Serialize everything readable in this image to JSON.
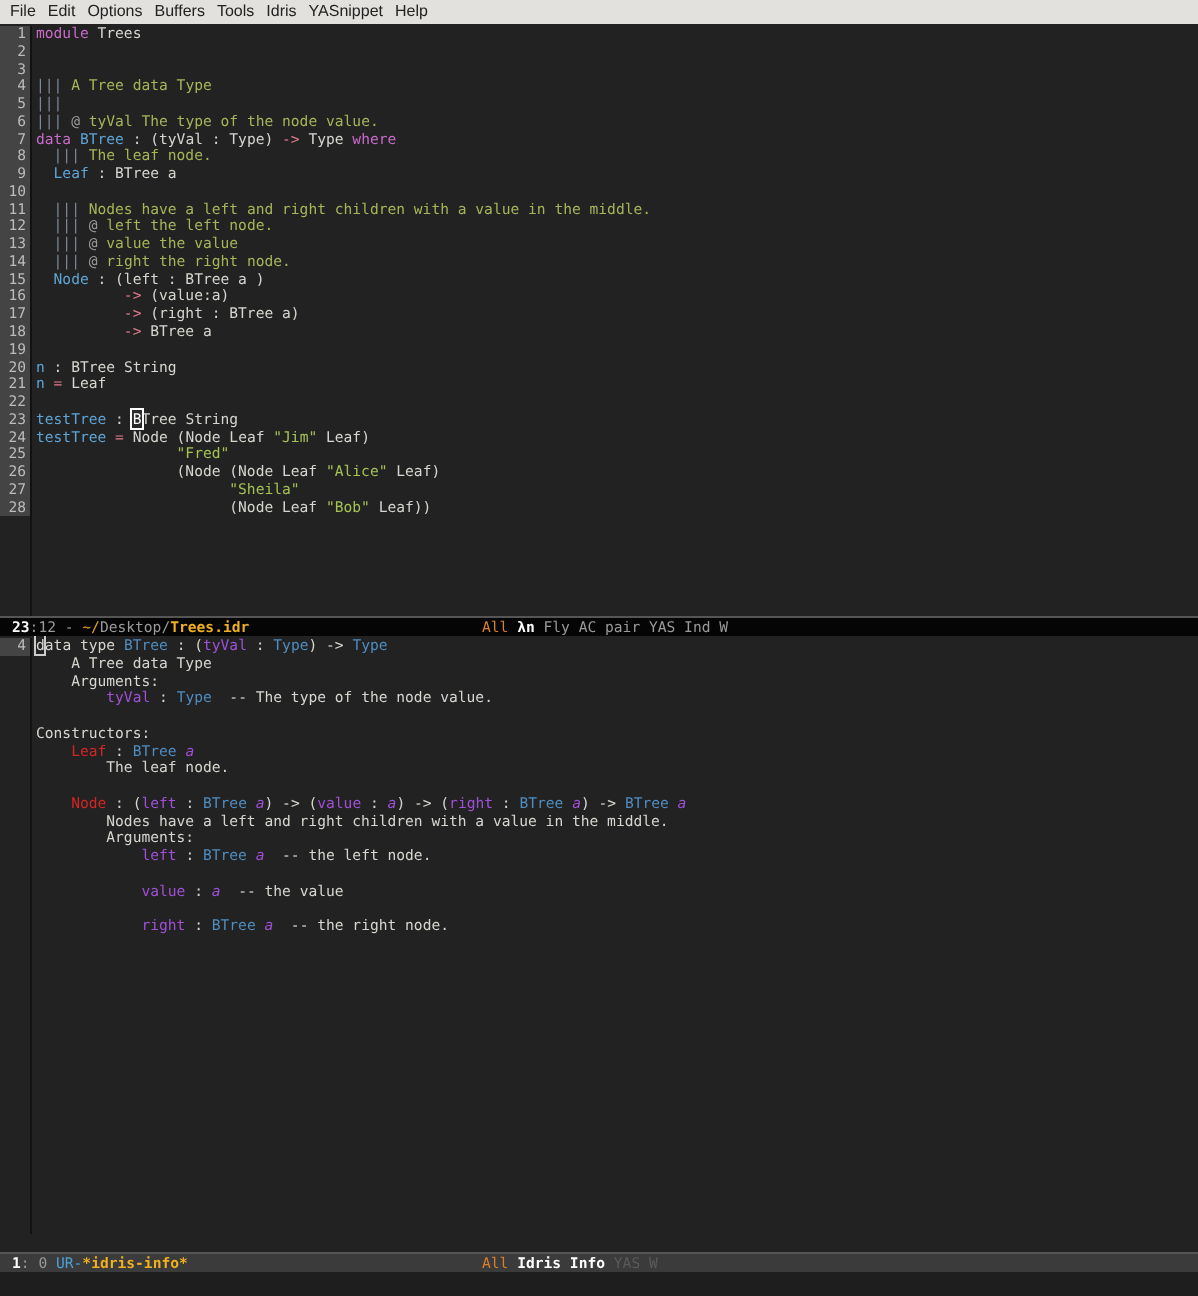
{
  "menu_bar": [
    "File",
    "Edit",
    "Options",
    "Buffers",
    "Tools",
    "Idris",
    "YASnippet",
    "Help"
  ],
  "editor": {
    "lines": [
      {
        "number": "1",
        "tokens": [
          {
            "kind": "keyword",
            "text": "module"
          },
          {
            "kind": "plain",
            "text": " Trees"
          }
        ]
      },
      {
        "number": "2"
      },
      {
        "number": "3"
      },
      {
        "number": "4",
        "tokens": [
          {
            "kind": "docbar",
            "text": "|||"
          },
          {
            "kind": "doc",
            "text": " A Tree data Type"
          }
        ]
      },
      {
        "number": "5",
        "tokens": [
          {
            "kind": "docbar",
            "text": "|||"
          }
        ]
      },
      {
        "number": "6",
        "tokens": [
          {
            "kind": "docbar",
            "text": "|||"
          },
          {
            "kind": "at",
            "text": " @"
          },
          {
            "kind": "doc",
            "text": " tyVal The type of the node value."
          }
        ]
      },
      {
        "number": "7",
        "tokens": [
          {
            "kind": "keyword",
            "text": "data"
          },
          {
            "kind": "type",
            "text": " BTree"
          },
          {
            "kind": "plain",
            "text": " : (tyVal : Type) "
          },
          {
            "kind": "arrow",
            "text": "->"
          },
          {
            "kind": "plain",
            "text": " Type "
          },
          {
            "kind": "keyword",
            "text": "where"
          }
        ]
      },
      {
        "number": "8",
        "tokens": [
          {
            "kind": "docbar",
            "text": "  |||"
          },
          {
            "kind": "doc",
            "text": " The leaf node."
          }
        ]
      },
      {
        "number": "9",
        "tokens": [
          {
            "kind": "type",
            "text": "  Leaf"
          },
          {
            "kind": "plain",
            "text": " : BTree a"
          }
        ]
      },
      {
        "number": "10"
      },
      {
        "number": "11",
        "tokens": [
          {
            "kind": "docbar",
            "text": "  |||"
          },
          {
            "kind": "doc",
            "text": " Nodes have a left and right children with a value in the middle."
          }
        ]
      },
      {
        "number": "12",
        "tokens": [
          {
            "kind": "docbar",
            "text": "  |||"
          },
          {
            "kind": "at",
            "text": " @"
          },
          {
            "kind": "doc",
            "text": " left the left node."
          }
        ]
      },
      {
        "number": "13",
        "tokens": [
          {
            "kind": "docbar",
            "text": "  |||"
          },
          {
            "kind": "at",
            "text": " @"
          },
          {
            "kind": "doc",
            "text": " value the value"
          }
        ]
      },
      {
        "number": "14",
        "tokens": [
          {
            "kind": "docbar",
            "text": "  |||"
          },
          {
            "kind": "at",
            "text": " @"
          },
          {
            "kind": "doc",
            "text": " right the right node."
          }
        ]
      },
      {
        "number": "15",
        "tokens": [
          {
            "kind": "type",
            "text": "  Node"
          },
          {
            "kind": "plain",
            "text": " : (left : BTree a )"
          }
        ]
      },
      {
        "number": "16",
        "tokens": [
          {
            "kind": "arrow",
            "text": "          ->"
          },
          {
            "kind": "plain",
            "text": " (value:a)"
          }
        ]
      },
      {
        "number": "17",
        "tokens": [
          {
            "kind": "arrow",
            "text": "          ->"
          },
          {
            "kind": "plain",
            "text": " (right : BTree a)"
          }
        ]
      },
      {
        "number": "18",
        "tokens": [
          {
            "kind": "arrow",
            "text": "          ->"
          },
          {
            "kind": "plain",
            "text": " BTree a"
          }
        ]
      },
      {
        "number": "19"
      },
      {
        "number": "20",
        "tokens": [
          {
            "kind": "type",
            "text": "n"
          },
          {
            "kind": "plain",
            "text": " : BTree String"
          }
        ]
      },
      {
        "number": "21",
        "tokens": [
          {
            "kind": "type",
            "text": "n"
          },
          {
            "kind": "arrow",
            "text": " ="
          },
          {
            "kind": "plain",
            "text": " Leaf"
          }
        ]
      },
      {
        "number": "22"
      },
      {
        "number": "23",
        "tokens": [
          {
            "kind": "type",
            "text": "testTree"
          },
          {
            "kind": "plain",
            "text": " : "
          },
          {
            "kind": "cursor",
            "text": "B"
          },
          {
            "kind": "plain",
            "text": "Tree String"
          }
        ]
      },
      {
        "number": "24",
        "tokens": [
          {
            "kind": "type",
            "text": "testTree"
          },
          {
            "kind": "arrow",
            "text": " ="
          },
          {
            "kind": "plain",
            "text": " Node (Node Leaf "
          },
          {
            "kind": "string",
            "text": "\"Jim\""
          },
          {
            "kind": "plain",
            "text": " Leaf)"
          }
        ]
      },
      {
        "number": "25",
        "tokens": [
          {
            "kind": "string",
            "text": "                \"Fred\""
          }
        ]
      },
      {
        "number": "26",
        "tokens": [
          {
            "kind": "plain",
            "text": "                (Node (Node Leaf "
          },
          {
            "kind": "string",
            "text": "\"Alice\""
          },
          {
            "kind": "plain",
            "text": " Leaf)"
          }
        ]
      },
      {
        "number": "27",
        "tokens": [
          {
            "kind": "string",
            "text": "                      \"Sheila\""
          }
        ]
      },
      {
        "number": "28",
        "tokens": [
          {
            "kind": "plain",
            "text": "                      (Node Leaf "
          },
          {
            "kind": "string",
            "text": "\"Bob\""
          },
          {
            "kind": "plain",
            "text": " Leaf))"
          }
        ]
      }
    ],
    "mode_line": {
      "active": true,
      "left": [
        {
          "kind": "bold",
          "text": "23"
        },
        {
          "kind": "dim",
          "text": ":12 - "
        },
        {
          "kind": "path",
          "text": "~/"
        },
        {
          "kind": "dim",
          "text": "Desktop/"
        },
        {
          "kind": "file",
          "text": "Trees.idr"
        }
      ],
      "right": [
        {
          "kind": "orange",
          "text": "All "
        },
        {
          "kind": "bold",
          "text": "λn"
        },
        {
          "kind": "dim",
          "text": " Fly AC pair YAS Ind W"
        }
      ]
    }
  },
  "info": {
    "lines": [
      {
        "kind": "text",
        "number": "4",
        "tokens": [
          {
            "kind": "cursor-hollow",
            "text": "d"
          },
          {
            "kind": "plain",
            "text": "ata type "
          },
          {
            "kind": "itype",
            "text": "BTree"
          },
          {
            "kind": "plain",
            "text": " : ("
          },
          {
            "kind": "param",
            "text": "tyVal"
          },
          {
            "kind": "plain",
            "text": " : "
          },
          {
            "kind": "itype",
            "text": "Type"
          },
          {
            "kind": "plain",
            "text": ") -> "
          },
          {
            "kind": "itype",
            "text": "Type"
          }
        ]
      },
      {
        "kind": "text",
        "tokens": [
          {
            "kind": "plain",
            "text": "    A Tree data Type"
          }
        ]
      },
      {
        "kind": "text",
        "tokens": [
          {
            "kind": "plain",
            "text": "    Arguments:"
          }
        ]
      },
      {
        "kind": "text",
        "tokens": [
          {
            "kind": "param",
            "text": "        tyVal"
          },
          {
            "kind": "plain",
            "text": " : "
          },
          {
            "kind": "itype",
            "text": "Type"
          },
          {
            "kind": "plain",
            "text": "  -- The type of the node value."
          }
        ]
      },
      {
        "kind": "blank"
      },
      {
        "kind": "text",
        "tokens": [
          {
            "kind": "plain",
            "text": "Constructors:"
          }
        ]
      },
      {
        "kind": "text",
        "tokens": [
          {
            "kind": "ctor",
            "text": "    Leaf"
          },
          {
            "kind": "plain",
            "text": " : "
          },
          {
            "kind": "itype",
            "text": "BTree"
          },
          {
            "kind": "tyvar",
            "text": " a"
          }
        ]
      },
      {
        "kind": "text",
        "tokens": [
          {
            "kind": "plain",
            "text": "        The leaf node."
          }
        ]
      },
      {
        "kind": "blank"
      },
      {
        "kind": "text",
        "tokens": [
          {
            "kind": "ctor",
            "text": "    Node"
          },
          {
            "kind": "plain",
            "text": " : ("
          },
          {
            "kind": "param",
            "text": "left"
          },
          {
            "kind": "plain",
            "text": " : "
          },
          {
            "kind": "itype",
            "text": "BTree"
          },
          {
            "kind": "tyvar",
            "text": " a"
          },
          {
            "kind": "plain",
            "text": ") -> ("
          },
          {
            "kind": "param",
            "text": "value"
          },
          {
            "kind": "plain",
            "text": " : "
          },
          {
            "kind": "tyvar",
            "text": "a"
          },
          {
            "kind": "plain",
            "text": ") -> ("
          },
          {
            "kind": "param",
            "text": "right"
          },
          {
            "kind": "plain",
            "text": " : "
          },
          {
            "kind": "itype",
            "text": "BTree"
          },
          {
            "kind": "tyvar",
            "text": " a"
          },
          {
            "kind": "plain",
            "text": ") -> "
          },
          {
            "kind": "itype",
            "text": "BTree"
          },
          {
            "kind": "tyvar",
            "text": " a"
          }
        ]
      },
      {
        "kind": "text",
        "tokens": [
          {
            "kind": "plain",
            "text": "        Nodes have a left and right children with a value in the middle."
          }
        ]
      },
      {
        "kind": "text",
        "tokens": [
          {
            "kind": "plain",
            "text": "        Arguments:"
          }
        ]
      },
      {
        "kind": "text",
        "tokens": [
          {
            "kind": "param",
            "text": "            left"
          },
          {
            "kind": "plain",
            "text": " : "
          },
          {
            "kind": "itype",
            "text": "BTree"
          },
          {
            "kind": "tyvar",
            "text": " a"
          },
          {
            "kind": "plain",
            "text": "  -- the left node."
          }
        ]
      },
      {
        "kind": "blank"
      },
      {
        "kind": "text",
        "tokens": [
          {
            "kind": "param",
            "text": "            value"
          },
          {
            "kind": "plain",
            "text": " : "
          },
          {
            "kind": "tyvar",
            "text": "a"
          },
          {
            "kind": "plain",
            "text": "  -- the value"
          }
        ]
      },
      {
        "kind": "blank"
      },
      {
        "kind": "text",
        "tokens": [
          {
            "kind": "param",
            "text": "            right"
          },
          {
            "kind": "plain",
            "text": " : "
          },
          {
            "kind": "itype",
            "text": "BTree"
          },
          {
            "kind": "tyvar",
            "text": " a"
          },
          {
            "kind": "plain",
            "text": "  -- the right node."
          }
        ]
      }
    ],
    "mode_line": {
      "active": false,
      "left": [
        {
          "kind": "bold",
          "text": "1"
        },
        {
          "kind": "dim",
          "text": ": 0 "
        },
        {
          "kind": "blue",
          "text": "UR-"
        },
        {
          "kind": "file",
          "text": "*idris-info*"
        }
      ],
      "right": [
        {
          "kind": "orange",
          "text": "All "
        },
        {
          "kind": "bold",
          "text": "Idris Info"
        },
        {
          "kind": "faint",
          "text": " YAS W"
        }
      ]
    }
  }
}
